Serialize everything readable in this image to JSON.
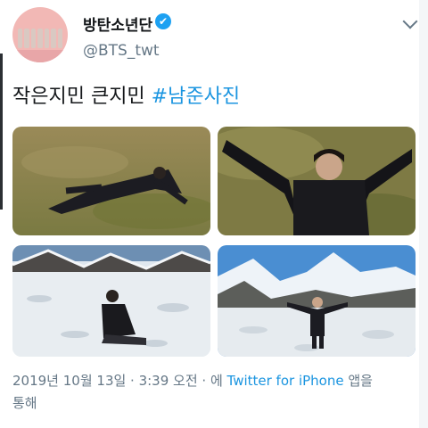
{
  "tweet": {
    "display_name": "방탄소년단",
    "handle": "@BTS_twt",
    "text": "작은지민 큰지민 ",
    "hashtag": "#남준사진",
    "date": "2019년 10월 13일 · 3:39 오전 · 에 ",
    "source": "Twitter for iPhone",
    "source_suffix": " 앱을",
    "source_suffix2": "통해",
    "verified_icon": "✔"
  },
  "photos": [
    {
      "description": "person-lying-on-grass"
    },
    {
      "description": "person-arms-outstretched-on-grass"
    },
    {
      "description": "person-sitting-on-snowy-mountain-lake"
    },
    {
      "description": "person-arms-outstretched-mountains"
    }
  ],
  "colors": {
    "link": "#1b95e0",
    "verified": "#1da1f2",
    "muted": "#657786"
  }
}
